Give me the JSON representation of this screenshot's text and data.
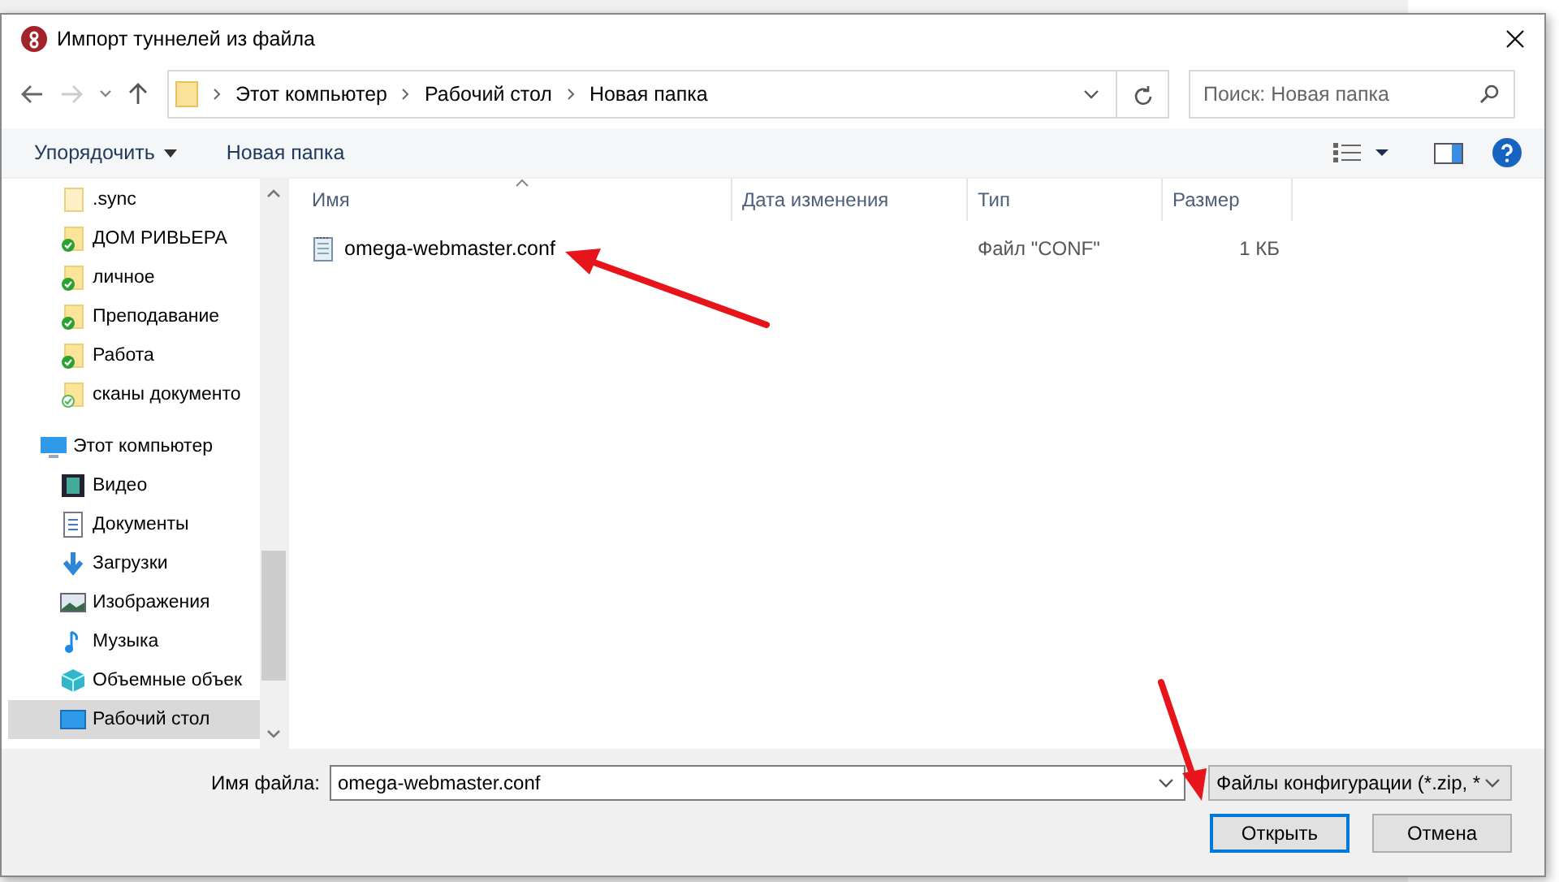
{
  "window": {
    "title": "Импорт туннелей из файла"
  },
  "address": {
    "crumbs": [
      "Этот компьютер",
      "Рабочий стол",
      "Новая папка"
    ]
  },
  "search": {
    "placeholder": "Поиск: Новая папка"
  },
  "toolbar": {
    "organize": "Упорядочить",
    "new_folder": "Новая папка"
  },
  "sidebar": {
    "items": [
      {
        "label": ".sync",
        "kind": "folder-faded",
        "selected": false
      },
      {
        "label": "ДОМ РИВЬЕРА",
        "kind": "folder-synced",
        "selected": false
      },
      {
        "label": "личное",
        "kind": "folder-synced",
        "selected": false
      },
      {
        "label": "Преподавание",
        "kind": "folder-synced",
        "selected": false
      },
      {
        "label": "Работа",
        "kind": "folder-synced",
        "selected": false
      },
      {
        "label": "сканы документо",
        "kind": "folder-pending",
        "selected": false
      },
      {
        "label": "Этот компьютер",
        "kind": "computer",
        "selected": false,
        "children": [
          {
            "label": "Видео",
            "kind": "video",
            "selected": false
          },
          {
            "label": "Документы",
            "kind": "documents",
            "selected": false
          },
          {
            "label": "Загрузки",
            "kind": "downloads",
            "selected": false
          },
          {
            "label": "Изображения",
            "kind": "pictures",
            "selected": false
          },
          {
            "label": "Музыка",
            "kind": "music",
            "selected": false
          },
          {
            "label": "Объемные объек",
            "kind": "objects",
            "selected": false
          },
          {
            "label": "Рабочий стол",
            "kind": "desktop",
            "selected": true
          }
        ]
      }
    ]
  },
  "table": {
    "columns": [
      "Имя",
      "Дата изменения",
      "Тип",
      "Размер"
    ],
    "rows": [
      {
        "name": "omega-webmaster.conf",
        "modified": "",
        "type": "Файл \"CONF\"",
        "size": "1 КБ"
      }
    ]
  },
  "filename": {
    "label": "Имя файла:",
    "value": "omega-webmaster.conf"
  },
  "filter": {
    "value": "Файлы конфигурации (*.zip, *"
  },
  "buttons": [
    {
      "label": "Открыть",
      "default": true
    },
    {
      "label": "Отмена",
      "default": false
    }
  ]
}
